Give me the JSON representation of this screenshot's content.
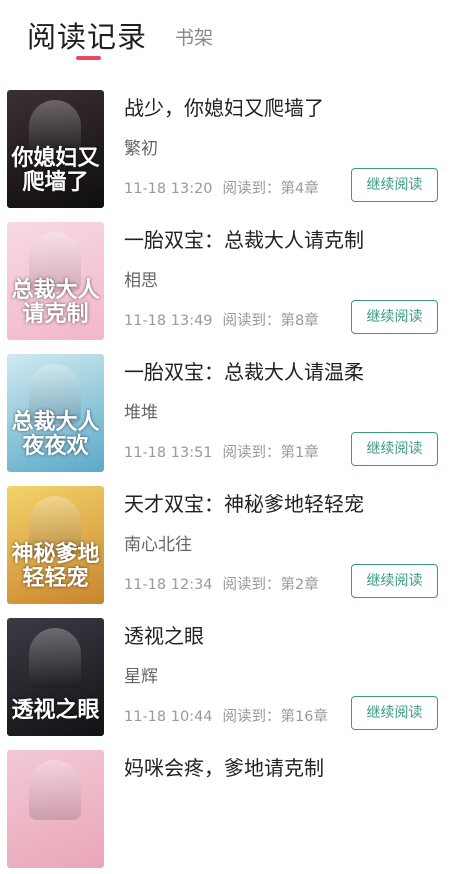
{
  "tabs": {
    "active_label": "阅读记录",
    "inactive_label": "书架"
  },
  "continue_label": "继续阅读",
  "progress_prefix": "阅读到：",
  "books": [
    {
      "title": "战少，你媳妇又爬墙了",
      "author": "繁初",
      "time": "11-18 13:20",
      "chapter": "第4章",
      "cover_text": "你媳妇又爬墙了",
      "cover_colors": [
        "#3b2f36",
        "#0f0d10"
      ]
    },
    {
      "title": "一胎双宝：总裁大人请克制",
      "author": "相思",
      "time": "11-18 13:49",
      "chapter": "第8章",
      "cover_text": "总裁大人请克制",
      "cover_colors": [
        "#f7d9e3",
        "#f2b7c7"
      ]
    },
    {
      "title": "一胎双宝：总裁大人请温柔",
      "author": "堆堆",
      "time": "11-18 13:51",
      "chapter": "第1章",
      "cover_text": "总裁大人夜夜欢",
      "cover_colors": [
        "#cfeaf0",
        "#5aa9c8"
      ]
    },
    {
      "title": "天才双宝：神秘爹地轻轻宠",
      "author": "南心北往",
      "time": "11-18 12:34",
      "chapter": "第2章",
      "cover_text": "神秘爹地轻轻宠",
      "cover_colors": [
        "#f3d36a",
        "#c9852e"
      ]
    },
    {
      "title": "透视之眼",
      "author": "星辉",
      "time": "11-18 10:44",
      "chapter": "第16章",
      "cover_text": "透视之眼",
      "cover_colors": [
        "#3b3b44",
        "#121216"
      ]
    },
    {
      "title": "妈咪会疼，爹地请克制",
      "author": "",
      "time": "",
      "chapter": "",
      "cover_text": "",
      "cover_colors": [
        "#f3c8d4",
        "#e9a7b9"
      ]
    }
  ]
}
